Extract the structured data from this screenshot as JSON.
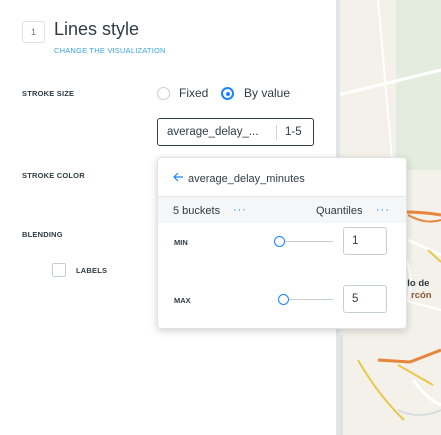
{
  "step": {
    "number": "1"
  },
  "header": {
    "title": "Lines style",
    "subtitle": "CHANGE THE VISUALIZATION"
  },
  "stroke_size": {
    "label": "STROKE SIZE",
    "options": [
      {
        "label": "Fixed",
        "selected": false
      },
      {
        "label": "By value",
        "selected": true
      }
    ],
    "attribute": {
      "name": "average_delay_...",
      "range": "1-5"
    }
  },
  "stroke_color": {
    "label": "STROKE COLOR"
  },
  "blending": {
    "label": "BLENDING"
  },
  "labels": {
    "label": "LABELS",
    "checked": false
  },
  "dropdown": {
    "back_icon": "arrow-left-icon",
    "header": "average_delay_minutes",
    "buckets": "5 buckets",
    "buckets_menu": "···",
    "quantification": "Quantiles",
    "quant_menu": "···",
    "min": {
      "label": "MIN",
      "value": "1"
    },
    "max": {
      "label": "MAX",
      "value": "5"
    }
  },
  "map": {
    "place_line1": "elo de",
    "place_line2": "rcón"
  },
  "colors": {
    "accent": "#1785fb",
    "subtitle": "#3aa3de",
    "text": "#2e3c43",
    "map_line": "#e8853d"
  }
}
